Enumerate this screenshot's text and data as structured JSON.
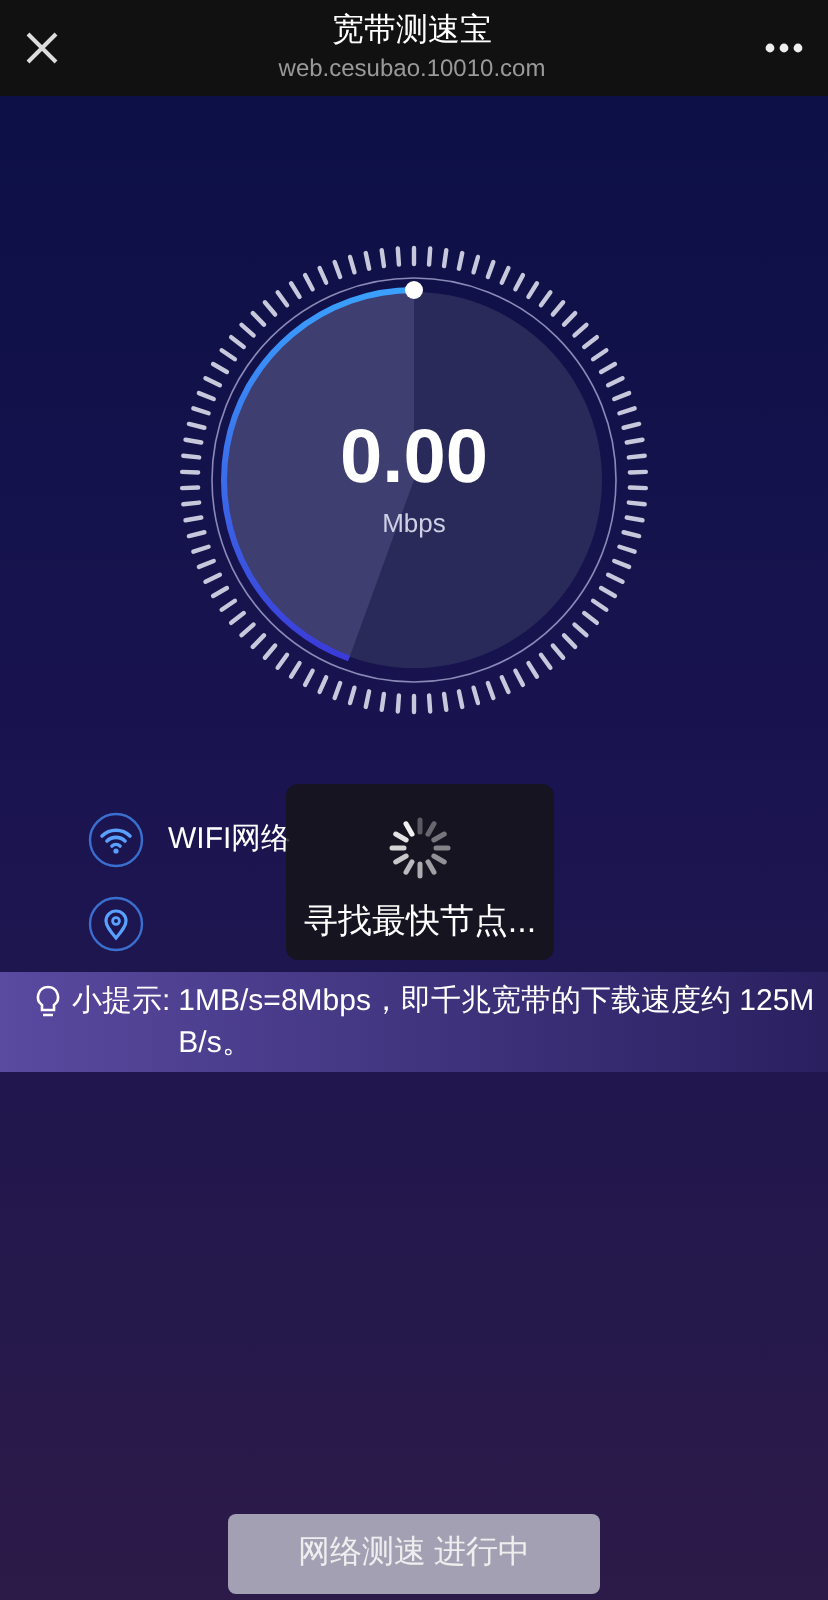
{
  "header": {
    "title": "宽带测速宝",
    "url": "web.cesubao.10010.com"
  },
  "gauge": {
    "value": "0.00",
    "unit": "Mbps"
  },
  "network": {
    "label": "WIFI网络"
  },
  "tip": {
    "label": "小提示:",
    "text": "1MB/s=8Mbps，即千兆宽带的下载速度约 125MB/s。"
  },
  "toast": {
    "text": "寻找最快节点..."
  },
  "button": {
    "label": "网络测速 进行中",
    "disabled": true
  }
}
